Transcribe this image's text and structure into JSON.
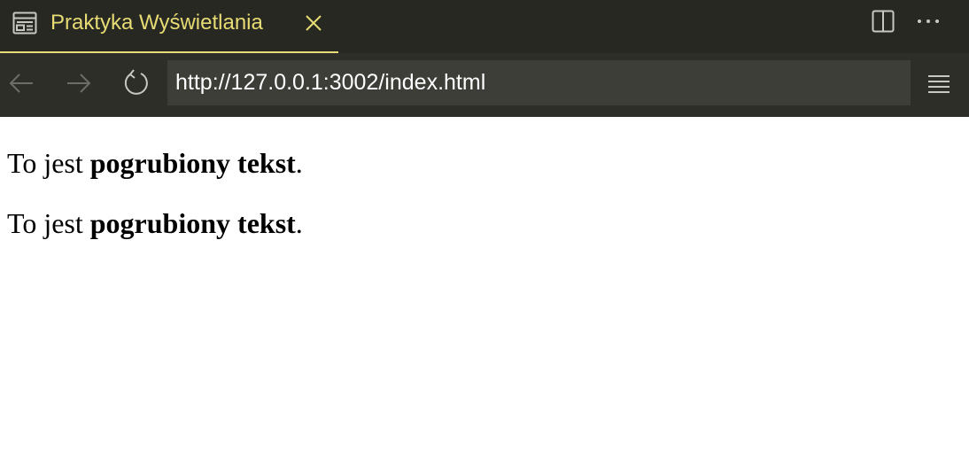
{
  "tab": {
    "title": "Praktyka Wyświetlania",
    "icon": "preview-icon",
    "close_icon": "close-icon"
  },
  "tab_actions": {
    "split_icon": "split-editor-icon",
    "more_icon": "more-actions-icon"
  },
  "toolbar": {
    "back_icon": "back-arrow-icon",
    "forward_icon": "forward-arrow-icon",
    "reload_icon": "reload-icon",
    "url": "http://127.0.0.1:3002/index.html",
    "menu_icon": "menu-icon"
  },
  "content": {
    "paragraphs": [
      {
        "prefix": "To jest ",
        "bold": "pogrubiony tekst",
        "suffix": "."
      },
      {
        "prefix": "To jest ",
        "bold": "pogrubiony tekst",
        "suffix": "."
      }
    ]
  },
  "colors": {
    "chrome_bg": "#272822",
    "toolbar_bg": "#2d2e28",
    "url_bg": "#3d3e38",
    "accent": "#e6db74",
    "icon": "#c8c8c2"
  }
}
